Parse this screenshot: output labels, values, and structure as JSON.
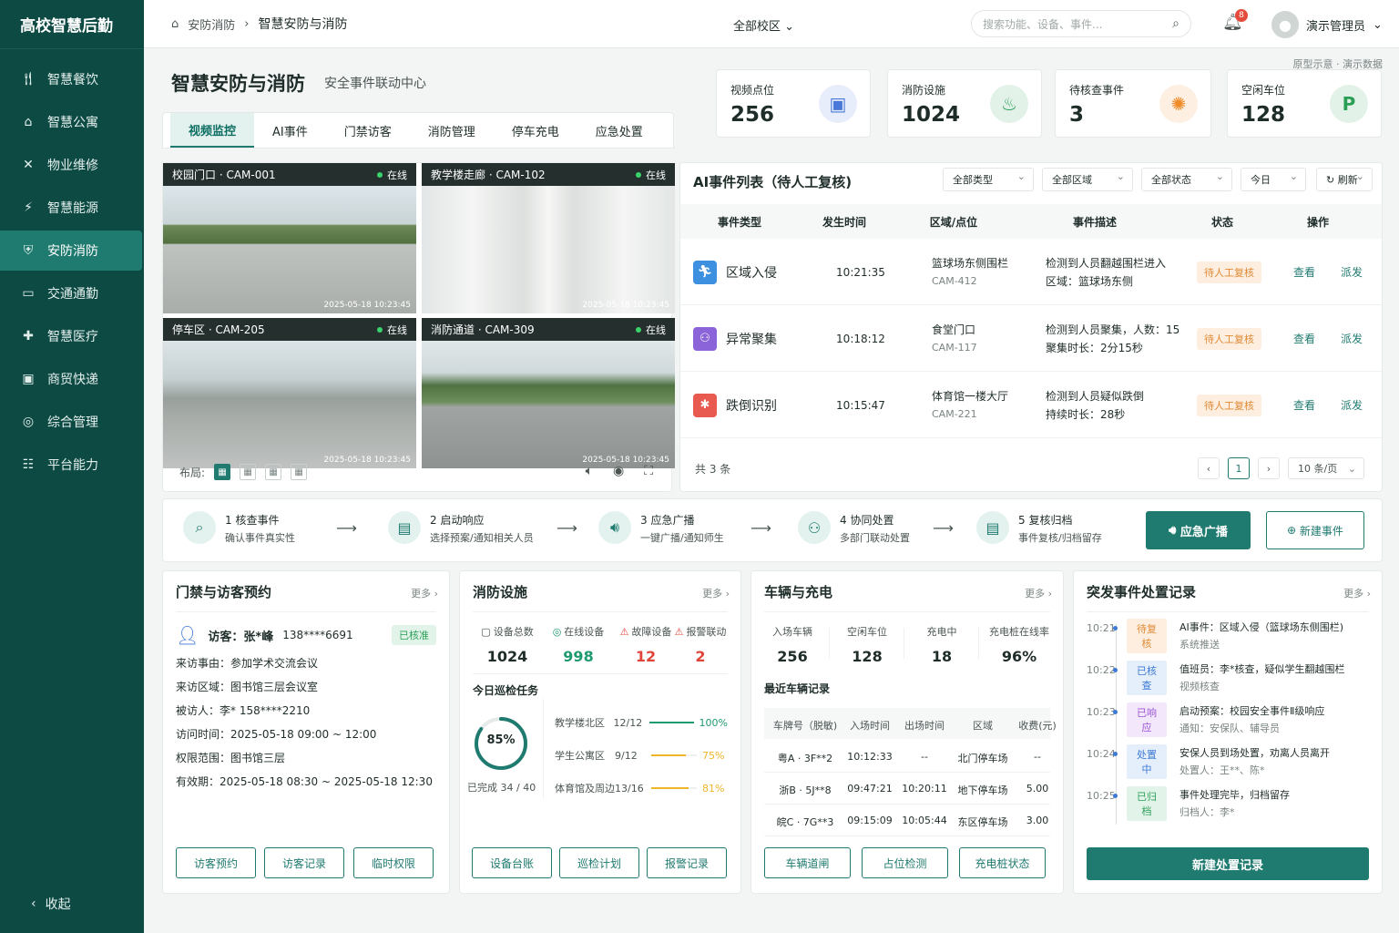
{
  "app": {
    "brand": "高校智慧后勤"
  },
  "sidebar": {
    "items": [
      {
        "label": "智慧餐饮",
        "icon": "dining-icon"
      },
      {
        "label": "智慧公寓",
        "icon": "apartment-icon"
      },
      {
        "label": "物业维修",
        "icon": "repair-icon"
      },
      {
        "label": "智慧能源",
        "icon": "energy-icon"
      },
      {
        "label": "安防消防",
        "icon": "shield-icon"
      },
      {
        "label": "交通通勤",
        "icon": "car-icon"
      },
      {
        "label": "智慧医疗",
        "icon": "medical-icon"
      },
      {
        "label": "商贸快递",
        "icon": "delivery-icon"
      },
      {
        "label": "综合管理",
        "icon": "admin-icon"
      },
      {
        "label": "平台能力",
        "icon": "platform-icon"
      }
    ],
    "active_index": 4,
    "collapse": "收起"
  },
  "topbar": {
    "crumb_parent": "安防消防",
    "crumb_current": "智慧安防与消防",
    "campus": "全部校区",
    "search_placeholder": "搜索功能、设备、事件...",
    "notifications": "8",
    "user": "演示管理员"
  },
  "page": {
    "title": "智慧安防与消防",
    "subtitle": "安全事件联动中心",
    "note": "原型示意 · 演示数据"
  },
  "tabs": [
    "视频监控",
    "AI事件",
    "门禁访客",
    "消防管理",
    "停车充电",
    "应急处置"
  ],
  "stats": [
    {
      "label": "视频点位",
      "value": "256",
      "icon": "monitor-icon",
      "color": "#4a78d8"
    },
    {
      "label": "消防设施",
      "value": "1024",
      "icon": "fire-extinguisher-icon",
      "color": "#2c9f57"
    },
    {
      "label": "待核查事件",
      "value": "3",
      "icon": "alarm-light-icon",
      "color": "#f08a24"
    },
    {
      "label": "空闲车位",
      "value": "128",
      "icon": "parking-icon",
      "color": "#2c9f57"
    }
  ],
  "cameras": [
    {
      "title": "校园门口 · CAM-001",
      "status": "在线",
      "time": "2025-05-18 10:23:45"
    },
    {
      "title": "教学楼走廊 · CAM-102",
      "status": "在线",
      "time": "2025-05-18 10:23:45"
    },
    {
      "title": "停车区 · CAM-205",
      "status": "在线",
      "time": "2025-05-18 10:23:45"
    },
    {
      "title": "消防通道 · CAM-309",
      "status": "在线",
      "time": "2025-05-18 10:23:45"
    }
  ],
  "video_controls": {
    "layout_label": "布局:"
  },
  "events": {
    "title": "AI事件列表（待人工复核)",
    "filters": [
      "全部类型",
      "全部区域",
      "全部状态",
      "今日"
    ],
    "refresh": "刷新",
    "columns": [
      "事件类型",
      "发生时间",
      "区域/点位",
      "事件描述",
      "状态",
      "操作"
    ],
    "rows": [
      {
        "type": "区域入侵",
        "time": "10:21:35",
        "loc": "篮球场东侧围栏",
        "cam": "CAM-412",
        "desc1": "检测到人员翻越围栏进入",
        "desc2": "区域：篮球场东侧",
        "status": "待人工复核",
        "view": "查看",
        "dispatch": "派发",
        "color": "#3d8fe0",
        "icon": "intrusion-icon"
      },
      {
        "type": "异常聚集",
        "time": "10:18:12",
        "loc": "食堂门口",
        "cam": "CAM-117",
        "desc1": "检测到人员聚集，人数：15",
        "desc2": "聚集时长：2分15秒",
        "status": "待人工复核",
        "view": "查看",
        "dispatch": "派发",
        "color": "#8a64d8",
        "icon": "crowd-icon"
      },
      {
        "type": "跌倒识别",
        "time": "10:15:47",
        "loc": "体育馆一楼大厅",
        "cam": "CAM-221",
        "desc1": "检测到人员疑似跌倒",
        "desc2": "持续时长：28秒",
        "status": "待人工复核",
        "view": "查看",
        "dispatch": "派发",
        "color": "#e85a4f",
        "icon": "fall-icon"
      }
    ],
    "total": "共 3 条",
    "page": "1",
    "page_size": "10 条/页"
  },
  "flow": {
    "steps": [
      {
        "title": "1 核查事件",
        "desc": "确认事件真实性",
        "icon": "verify-icon"
      },
      {
        "title": "2 启动响应",
        "desc": "选择预案/通知相关人员",
        "icon": "response-icon"
      },
      {
        "title": "3 应急广播",
        "desc": "一键广播/通知师生",
        "icon": "broadcast-icon"
      },
      {
        "title": "4 协同处置",
        "desc": "多部门联动处置",
        "icon": "team-icon"
      },
      {
        "title": "5 复核归档",
        "desc": "事件复核/归档留存",
        "icon": "archive-icon"
      }
    ],
    "broadcast_btn": "应急广播",
    "new_event_btn": "新建事件"
  },
  "access": {
    "title": "门禁与访客预约",
    "more": "更多",
    "visitor": "访客：张*峰",
    "phone": "138****6691",
    "badge": "已核准",
    "lines": [
      "来访事由：参加学术交流会议",
      "来访区域：图书馆三层会议室",
      "被访人：李*    158****2210",
      "访问时间：2025-05-18 09:00 ~ 12:00",
      "权限范围：图书馆三层",
      "有效期：2025-05-18 08:30 ~ 2025-05-18 12:30"
    ],
    "buttons": [
      "访客预约",
      "访客记录",
      "临时权限"
    ]
  },
  "fire": {
    "title": "消防设施",
    "more": "更多",
    "kpis": [
      {
        "label": "设备总数",
        "value": "1024",
        "color": "#1f2d2a"
      },
      {
        "label": "在线设备",
        "value": "998",
        "color": "#1f9a6e"
      },
      {
        "label": "故障设备",
        "value": "12",
        "color": "#e0453a"
      },
      {
        "label": "报警联动",
        "value": "2",
        "color": "#e0453a"
      }
    ],
    "patrol_title": "今日巡检任务",
    "progress": "85%",
    "progress_value": 0.85,
    "done": "已完成 34 / 40",
    "patrols": [
      {
        "area": "教学楼北区",
        "count": "12/12",
        "pct": "100%",
        "value": 1.0,
        "color": "#1f9a6e"
      },
      {
        "area": "学生公寓区",
        "count": "9/12",
        "pct": "75%",
        "value": 0.75,
        "color": "#f0b429"
      },
      {
        "area": "体育馆及周边",
        "count": "13/16",
        "pct": "81%",
        "value": 0.81,
        "color": "#f0b429"
      }
    ],
    "buttons": [
      "设备台账",
      "巡检计划",
      "报警记录"
    ]
  },
  "vehicle": {
    "title": "车辆与充电",
    "more": "更多",
    "kpis": [
      {
        "label": "入场车辆",
        "value": "256"
      },
      {
        "label": "空闲车位",
        "value": "128"
      },
      {
        "label": "充电中",
        "value": "18"
      },
      {
        "label": "充电桩在线率",
        "value": "96%"
      }
    ],
    "records_title": "最近车辆记录",
    "columns": [
      "车牌号（脱敏)",
      "入场时间",
      "出场时间",
      "区域",
      "收费(元)"
    ],
    "rows": [
      [
        "粤A · 3F**2",
        "10:12:33",
        "--",
        "北门停车场",
        "--"
      ],
      [
        "浙B · 5J**8",
        "09:47:21",
        "10:20:11",
        "地下停车场",
        "5.00"
      ],
      [
        "皖C · 7G**3",
        "09:15:09",
        "10:05:44",
        "东区停车场",
        "3.00"
      ]
    ],
    "buttons": [
      "车辆道闸",
      "占位检测",
      "充电桩状态"
    ]
  },
  "incidents": {
    "title": "突发事件处置记录",
    "more": "更多",
    "items": [
      {
        "time": "10:21",
        "tag": "待复核",
        "main": "AI事件：区域入侵（篮球场东侧围栏)",
        "sub": "系统推送",
        "bg": "#fdeee0",
        "fg": "#e08a33"
      },
      {
        "time": "10:22",
        "tag": "已核查",
        "main": "值班员：李*核查，疑似学生翻越围栏",
        "sub": "视频核查",
        "bg": "#e5eefb",
        "fg": "#3d7ad6"
      },
      {
        "time": "10:23",
        "tag": "已响应",
        "main": "启动预案：校园安全事件Ⅱ级响应",
        "sub": "通知：安保队、辅导员",
        "bg": "#f3e8fb",
        "fg": "#9b54d2"
      },
      {
        "time": "10:24",
        "tag": "处置中",
        "main": "安保人员到场处置，劝离人员离开",
        "sub": "处置人：王**、陈*",
        "bg": "#e5eefb",
        "fg": "#3d7ad6"
      },
      {
        "time": "10:25",
        "tag": "已归档",
        "main": "事件处理完毕，归档留存",
        "sub": "归档人：李*",
        "bg": "#e2f4ea",
        "fg": "#2c9f57"
      }
    ],
    "button": "新建处置记录"
  }
}
